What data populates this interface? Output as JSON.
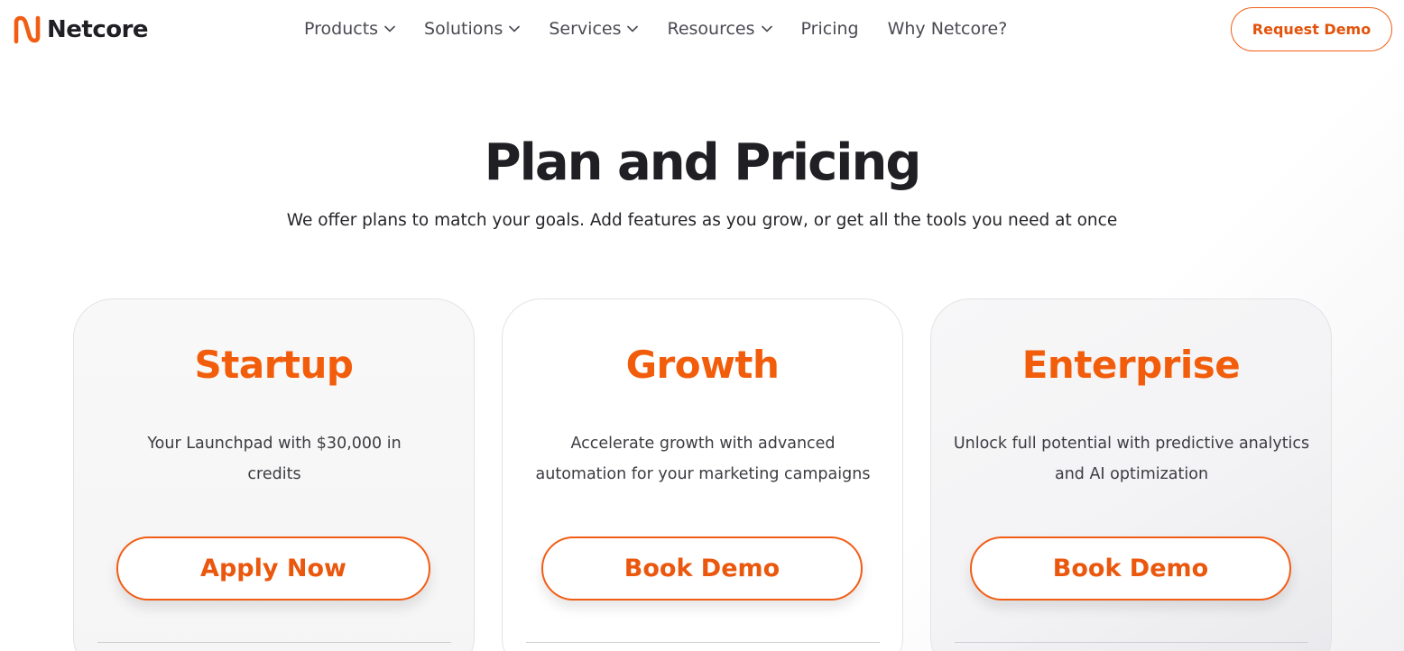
{
  "brand": {
    "name": "Netcore",
    "accent": "#f25d14"
  },
  "nav": {
    "items": [
      {
        "label": "Products",
        "dropdown": true
      },
      {
        "label": "Solutions",
        "dropdown": true
      },
      {
        "label": "Services",
        "dropdown": true
      },
      {
        "label": "Resources",
        "dropdown": true
      },
      {
        "label": "Pricing",
        "dropdown": false
      },
      {
        "label": "Why Netcore?",
        "dropdown": false
      }
    ],
    "cta_label": "Request Demo"
  },
  "hero": {
    "title": "Plan and Pricing",
    "subtitle": "We offer plans to match your goals. Add features as you grow, or get all the tools you need at once"
  },
  "plans": [
    {
      "name": "Startup",
      "description": "Your Launchpad with $30,000 in credits",
      "button_label": "Apply Now"
    },
    {
      "name": "Growth",
      "description": "Accelerate growth with advanced automation for your marketing campaigns",
      "button_label": "Book Demo"
    },
    {
      "name": "Enterprise",
      "description": "Unlock full potential with predictive analytics and AI optimization",
      "button_label": "Book Demo"
    }
  ]
}
